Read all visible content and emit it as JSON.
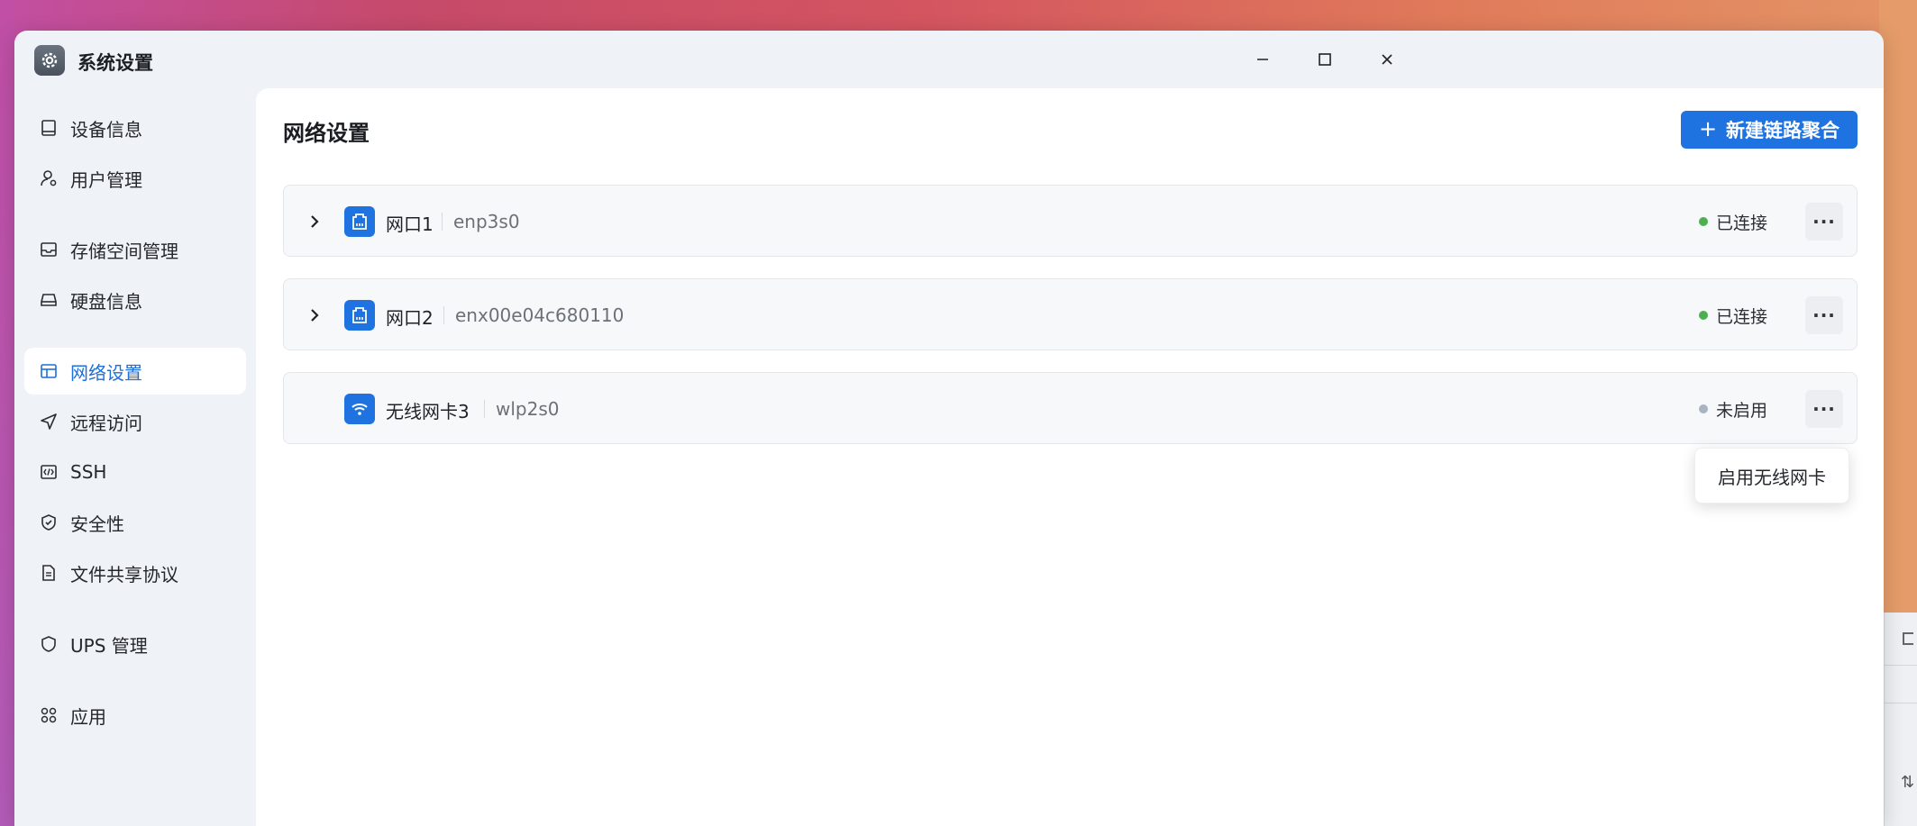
{
  "window": {
    "title": "系统设置",
    "controls": [
      "minimize-icon",
      "maximize-icon",
      "close-icon"
    ]
  },
  "sidebar": {
    "items": [
      {
        "label": "设备信息",
        "icon": "device-icon",
        "active": false
      },
      {
        "label": "用户管理",
        "icon": "user-gear-icon",
        "active": false
      },
      {
        "label": "存储空间管理",
        "icon": "inbox-icon",
        "active": false
      },
      {
        "label": "硬盘信息",
        "icon": "hard-drive-icon",
        "active": false
      },
      {
        "label": "网络设置",
        "icon": "network-window-icon",
        "active": true
      },
      {
        "label": "远程访问",
        "icon": "send-icon",
        "active": false
      },
      {
        "label": "SSH",
        "icon": "code-icon",
        "active": false
      },
      {
        "label": "安全性",
        "icon": "shield-check-icon",
        "active": false
      },
      {
        "label": "文件共享协议",
        "icon": "document-icon",
        "active": false
      },
      {
        "label": "UPS 管理",
        "icon": "shield-icon",
        "active": false
      },
      {
        "label": "应用",
        "icon": "apps-grid-icon",
        "active": false
      }
    ]
  },
  "main": {
    "title": "网络设置",
    "new_button_label": "新建链路聚合",
    "new_button_icon": "+",
    "interfaces": [
      {
        "name": "网口1",
        "device": "enp3s0",
        "status": "已连接",
        "status_color": "#4caf50",
        "type": "ethernet",
        "expandable": true
      },
      {
        "name": "网口2",
        "device": "enx00e04c680110",
        "status": "已连接",
        "status_color": "#4caf50",
        "type": "ethernet",
        "expandable": true
      },
      {
        "name": "无线网卡3",
        "device": "wlp2s0",
        "status": "未启用",
        "status_color": "#a9b3c1",
        "type": "wifi",
        "expandable": false
      }
    ],
    "more_label": "···",
    "popup_menu": {
      "items": [
        "启用无线网卡"
      ]
    }
  },
  "colors": {
    "accent": "#1f73e0",
    "connected": "#4caf50",
    "disabled": "#a9b3c1"
  }
}
